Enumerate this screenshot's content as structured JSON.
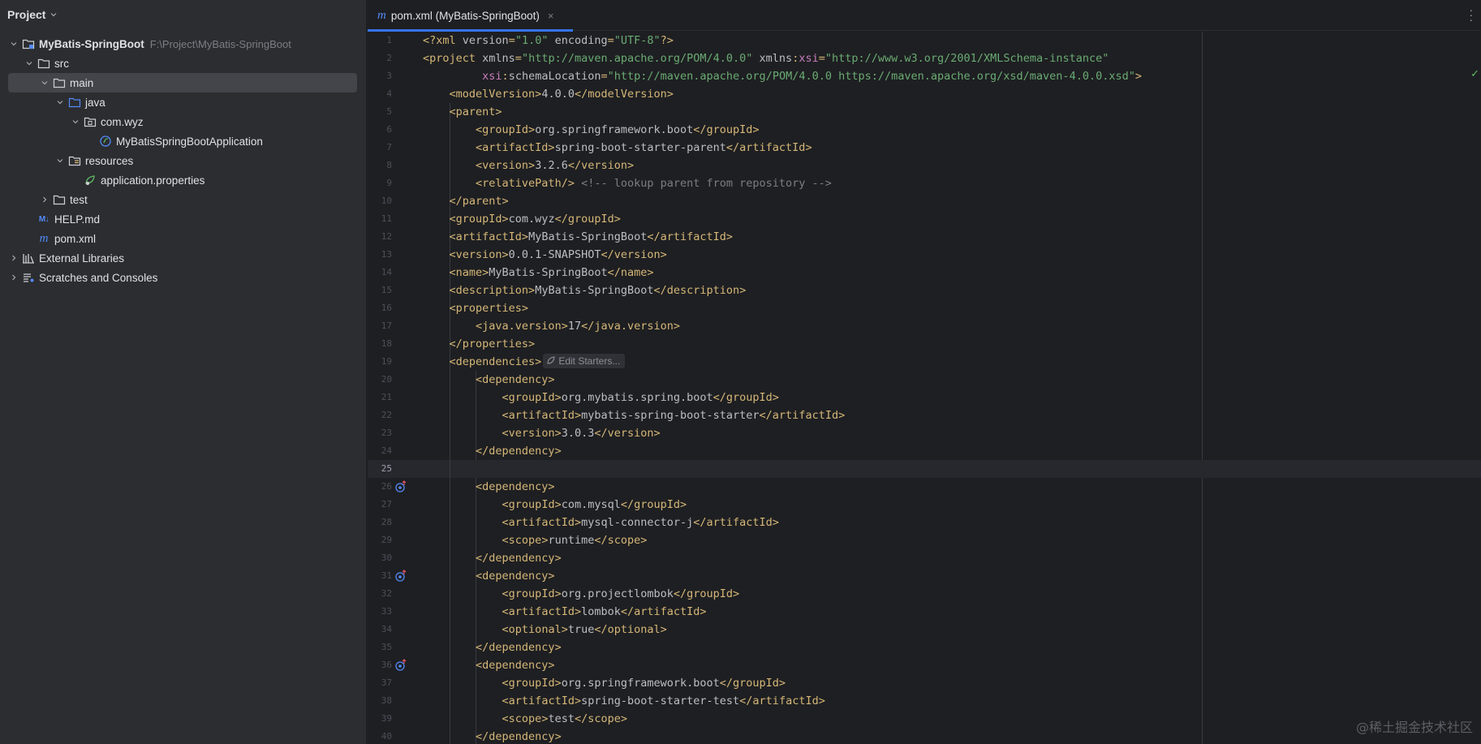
{
  "project_panel": {
    "title": "Project",
    "tree": [
      {
        "label": "MyBatis-SpringBoot",
        "hint": "F:\\Project\\MyBatis-SpringBoot",
        "icon": "module-folder-icon",
        "depth": 0,
        "expanded": true,
        "bold": true
      },
      {
        "label": "src",
        "icon": "folder-icon",
        "depth": 1,
        "expanded": true
      },
      {
        "label": "main",
        "icon": "folder-icon",
        "depth": 2,
        "expanded": true,
        "selected": true
      },
      {
        "label": "java",
        "icon": "source-folder-icon",
        "depth": 3,
        "expanded": true
      },
      {
        "label": "com.wyz",
        "icon": "package-icon",
        "depth": 4,
        "expanded": true
      },
      {
        "label": "MyBatisSpringBootApplication",
        "icon": "spring-class-icon",
        "depth": 5
      },
      {
        "label": "resources",
        "icon": "resources-folder-icon",
        "depth": 3,
        "expanded": true
      },
      {
        "label": "application.properties",
        "icon": "spring-properties-icon",
        "depth": 4
      },
      {
        "label": "test",
        "icon": "folder-icon",
        "depth": 2,
        "expanded": false
      },
      {
        "label": "HELP.md",
        "icon": "markdown-icon",
        "depth": 1
      },
      {
        "label": "pom.xml",
        "icon": "maven-icon",
        "depth": 1
      },
      {
        "label": "External Libraries",
        "icon": "library-icon",
        "depth": 0,
        "expanded": false
      },
      {
        "label": "Scratches and Consoles",
        "icon": "scratches-icon",
        "depth": 0,
        "expanded": false
      }
    ]
  },
  "editor": {
    "tab": {
      "label": "pom.xml (MyBatis-SpringBoot)",
      "close": "×"
    },
    "current_line": 25,
    "inlay_hint": "Edit Starters...",
    "watermark": "@稀土掘金技术社区",
    "lines": [
      [
        [
          "tag",
          "<?xml "
        ],
        [
          "attr",
          "version"
        ],
        [
          "tag",
          "="
        ],
        [
          "str",
          "\"1.0\""
        ],
        [
          "attr",
          " encoding"
        ],
        [
          "tag",
          "="
        ],
        [
          "str",
          "\"UTF-8\""
        ],
        [
          "tag",
          "?>"
        ]
      ],
      [
        [
          "tag",
          "<project "
        ],
        [
          "attr",
          "xmlns"
        ],
        [
          "tag",
          "="
        ],
        [
          "str",
          "\"http://maven.apache.org/POM/4.0.0\""
        ],
        [
          "attr",
          " xmlns"
        ],
        [
          "tag",
          ":"
        ],
        [
          "ns",
          "xsi"
        ],
        [
          "tag",
          "="
        ],
        [
          "str",
          "\"http://www.w3.org/2001/XMLSchema-instance\""
        ]
      ],
      [
        [
          "text",
          "         "
        ],
        [
          "ns",
          "xsi"
        ],
        [
          "tag",
          ":"
        ],
        [
          "attr",
          "schemaLocation"
        ],
        [
          "tag",
          "="
        ],
        [
          "str",
          "\"http://maven.apache.org/POM/4.0.0 https://maven.apache.org/xsd/maven-4.0.0.xsd\""
        ],
        [
          "tag",
          ">"
        ]
      ],
      [
        [
          "text",
          "    "
        ],
        [
          "tag",
          "<modelVersion>"
        ],
        [
          "text",
          "4.0.0"
        ],
        [
          "tag",
          "</modelVersion>"
        ]
      ],
      [
        [
          "text",
          "    "
        ],
        [
          "tag",
          "<parent>"
        ]
      ],
      [
        [
          "text",
          "        "
        ],
        [
          "tag",
          "<groupId>"
        ],
        [
          "text",
          "org.springframework.boot"
        ],
        [
          "tag",
          "</groupId>"
        ]
      ],
      [
        [
          "text",
          "        "
        ],
        [
          "tag",
          "<artifactId>"
        ],
        [
          "text",
          "spring-boot-starter-parent"
        ],
        [
          "tag",
          "</artifactId>"
        ]
      ],
      [
        [
          "text",
          "        "
        ],
        [
          "tag",
          "<version>"
        ],
        [
          "text",
          "3.2.6"
        ],
        [
          "tag",
          "</version>"
        ]
      ],
      [
        [
          "text",
          "        "
        ],
        [
          "tag",
          "<relativePath/>"
        ],
        [
          "comment",
          " <!-- lookup parent from repository -->"
        ]
      ],
      [
        [
          "text",
          "    "
        ],
        [
          "tag",
          "</parent>"
        ]
      ],
      [
        [
          "text",
          "    "
        ],
        [
          "tag",
          "<groupId>"
        ],
        [
          "text",
          "com.wyz"
        ],
        [
          "tag",
          "</groupId>"
        ]
      ],
      [
        [
          "text",
          "    "
        ],
        [
          "tag",
          "<artifactId>"
        ],
        [
          "text",
          "MyBatis-SpringBoot"
        ],
        [
          "tag",
          "</artifactId>"
        ]
      ],
      [
        [
          "text",
          "    "
        ],
        [
          "tag",
          "<version>"
        ],
        [
          "text",
          "0.0.1-SNAPSHOT"
        ],
        [
          "tag",
          "</version>"
        ]
      ],
      [
        [
          "text",
          "    "
        ],
        [
          "tag",
          "<name>"
        ],
        [
          "text",
          "MyBatis-SpringBoot"
        ],
        [
          "tag",
          "</name>"
        ]
      ],
      [
        [
          "text",
          "    "
        ],
        [
          "tag",
          "<description>"
        ],
        [
          "text",
          "MyBatis-SpringBoot"
        ],
        [
          "tag",
          "</description>"
        ]
      ],
      [
        [
          "text",
          "    "
        ],
        [
          "tag",
          "<properties>"
        ]
      ],
      [
        [
          "text",
          "        "
        ],
        [
          "tag",
          "<java.version>"
        ],
        [
          "text",
          "17"
        ],
        [
          "tag",
          "</java.version>"
        ]
      ],
      [
        [
          "text",
          "    "
        ],
        [
          "tag",
          "</properties>"
        ]
      ],
      [
        [
          "text",
          "    "
        ],
        [
          "tag",
          "<dependencies>"
        ],
        [
          "inlay",
          ""
        ]
      ],
      [
        [
          "text",
          "        "
        ],
        [
          "tag",
          "<dependency>"
        ]
      ],
      [
        [
          "text",
          "            "
        ],
        [
          "tag",
          "<groupId>"
        ],
        [
          "text",
          "org.mybatis.spring.boot"
        ],
        [
          "tag",
          "</groupId>"
        ]
      ],
      [
        [
          "text",
          "            "
        ],
        [
          "tag",
          "<artifactId>"
        ],
        [
          "text",
          "mybatis-spring-boot-starter"
        ],
        [
          "tag",
          "</artifactId>"
        ]
      ],
      [
        [
          "text",
          "            "
        ],
        [
          "tag",
          "<version>"
        ],
        [
          "text",
          "3.0.3"
        ],
        [
          "tag",
          "</version>"
        ]
      ],
      [
        [
          "text",
          "        "
        ],
        [
          "tag",
          "</dependency>"
        ]
      ],
      [],
      [
        [
          "text",
          "        "
        ],
        [
          "tag",
          "<dependency>"
        ]
      ],
      [
        [
          "text",
          "            "
        ],
        [
          "tag",
          "<groupId>"
        ],
        [
          "text",
          "com.mysql"
        ],
        [
          "tag",
          "</groupId>"
        ]
      ],
      [
        [
          "text",
          "            "
        ],
        [
          "tag",
          "<artifactId>"
        ],
        [
          "text",
          "mysql-connector-j"
        ],
        [
          "tag",
          "</artifactId>"
        ]
      ],
      [
        [
          "text",
          "            "
        ],
        [
          "tag",
          "<scope>"
        ],
        [
          "text",
          "runtime"
        ],
        [
          "tag",
          "</scope>"
        ]
      ],
      [
        [
          "text",
          "        "
        ],
        [
          "tag",
          "</dependency>"
        ]
      ],
      [
        [
          "text",
          "        "
        ],
        [
          "tag",
          "<dependency>"
        ]
      ],
      [
        [
          "text",
          "            "
        ],
        [
          "tag",
          "<groupId>"
        ],
        [
          "text",
          "org.projectlombok"
        ],
        [
          "tag",
          "</groupId>"
        ]
      ],
      [
        [
          "text",
          "            "
        ],
        [
          "tag",
          "<artifactId>"
        ],
        [
          "text",
          "lombok"
        ],
        [
          "tag",
          "</artifactId>"
        ]
      ],
      [
        [
          "text",
          "            "
        ],
        [
          "tag",
          "<optional>"
        ],
        [
          "text",
          "true"
        ],
        [
          "tag",
          "</optional>"
        ]
      ],
      [
        [
          "text",
          "        "
        ],
        [
          "tag",
          "</dependency>"
        ]
      ],
      [
        [
          "text",
          "        "
        ],
        [
          "tag",
          "<dependency>"
        ]
      ],
      [
        [
          "text",
          "            "
        ],
        [
          "tag",
          "<groupId>"
        ],
        [
          "text",
          "org.springframework.boot"
        ],
        [
          "tag",
          "</groupId>"
        ]
      ],
      [
        [
          "text",
          "            "
        ],
        [
          "tag",
          "<artifactId>"
        ],
        [
          "text",
          "spring-boot-starter-test"
        ],
        [
          "tag",
          "</artifactId>"
        ]
      ],
      [
        [
          "text",
          "            "
        ],
        [
          "tag",
          "<scope>"
        ],
        [
          "text",
          "test"
        ],
        [
          "tag",
          "</scope>"
        ]
      ],
      [
        [
          "text",
          "        "
        ],
        [
          "tag",
          "</dependency>"
        ]
      ]
    ],
    "dependency_gutter_icon_lines": [
      26,
      31,
      36
    ]
  }
}
